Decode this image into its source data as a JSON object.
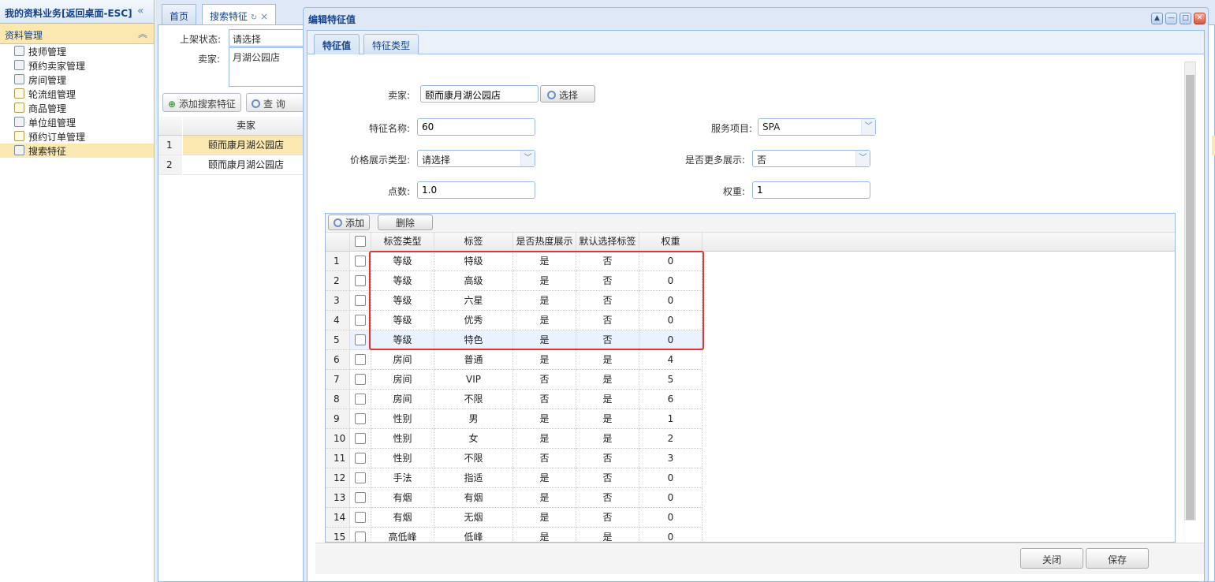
{
  "sidebar": {
    "title": "我的资料业务[返回桌面-ESC]",
    "section": "资料管理",
    "items": [
      {
        "label": "技师管理",
        "icon": "user-icon"
      },
      {
        "label": "预约卖家管理",
        "icon": "user-icon"
      },
      {
        "label": "房间管理",
        "icon": "user-icon"
      },
      {
        "label": "轮流组管理",
        "icon": "doc-icon"
      },
      {
        "label": "商品管理",
        "icon": "doc-icon"
      },
      {
        "label": "单位组管理",
        "icon": "user-icon"
      },
      {
        "label": "预约订单管理",
        "icon": "doc-icon"
      },
      {
        "label": "搜索特征",
        "icon": "user-icon",
        "active": true
      }
    ]
  },
  "tabs": [
    {
      "label": "首页"
    },
    {
      "label": "搜索特征 ",
      "refresh": "↻",
      "close": "×"
    }
  ],
  "background": {
    "status_label": "上架状态:",
    "status_value": "请选择",
    "seller_label": "卖家:",
    "seller_value": "月湖公园店",
    "add_button": "添加搜索特征",
    "query_button": "查 询",
    "column_seller": "卖家",
    "rows": [
      {
        "num": "1",
        "seller": "颐而康月湖公园店"
      },
      {
        "num": "2",
        "seller": "颐而康月湖公园店"
      }
    ]
  },
  "dialog": {
    "title": "编辑特征值",
    "tabs": [
      "特征值",
      "特征类型"
    ],
    "form": {
      "seller_label": "卖家:",
      "seller_value": "颐而康月湖公园店",
      "select_button": "选择",
      "name_label": "特征名称:",
      "name_value": "60",
      "service_label": "服务项目:",
      "service_value": "SPA",
      "price_type_label": "价格展示类型:",
      "price_type_value": "请选择",
      "more_label": "是否更多展示:",
      "more_value": "否",
      "points_label": "点数:",
      "points_value": "1.0",
      "weight_label": "权重:",
      "weight_value": "1"
    },
    "grid": {
      "add_button": "添加",
      "delete_button": "删除",
      "columns": [
        "标签类型",
        "标签",
        "是否热度展示",
        "默认选择标签",
        "权重"
      ],
      "rows": [
        {
          "num": "1",
          "type": "等级",
          "tag": "特级",
          "hot": "是",
          "default": "否",
          "weight": "0"
        },
        {
          "num": "2",
          "type": "等级",
          "tag": "高级",
          "hot": "是",
          "default": "否",
          "weight": "0"
        },
        {
          "num": "3",
          "type": "等级",
          "tag": "六星",
          "hot": "是",
          "default": "否",
          "weight": "0"
        },
        {
          "num": "4",
          "type": "等级",
          "tag": "优秀",
          "hot": "是",
          "default": "否",
          "weight": "0"
        },
        {
          "num": "5",
          "type": "等级",
          "tag": "特色",
          "hot": "是",
          "default": "否",
          "weight": "0"
        },
        {
          "num": "6",
          "type": "房间",
          "tag": "普通",
          "hot": "是",
          "default": "是",
          "weight": "4"
        },
        {
          "num": "7",
          "type": "房间",
          "tag": "VIP",
          "hot": "否",
          "default": "是",
          "weight": "5"
        },
        {
          "num": "8",
          "type": "房间",
          "tag": "不限",
          "hot": "否",
          "default": "是",
          "weight": "6"
        },
        {
          "num": "9",
          "type": "性别",
          "tag": "男",
          "hot": "是",
          "default": "是",
          "weight": "1"
        },
        {
          "num": "10",
          "type": "性别",
          "tag": "女",
          "hot": "是",
          "default": "是",
          "weight": "2"
        },
        {
          "num": "11",
          "type": "性别",
          "tag": "不限",
          "hot": "否",
          "default": "否",
          "weight": "3"
        },
        {
          "num": "12",
          "type": "手法",
          "tag": "指适",
          "hot": "是",
          "default": "否",
          "weight": "0"
        },
        {
          "num": "13",
          "type": "有烟",
          "tag": "有烟",
          "hot": "是",
          "default": "否",
          "weight": "0"
        },
        {
          "num": "14",
          "type": "有烟",
          "tag": "无烟",
          "hot": "是",
          "default": "否",
          "weight": "0"
        },
        {
          "num": "15",
          "type": "高低峰",
          "tag": "低峰",
          "hot": "是",
          "default": "是",
          "weight": "0"
        }
      ]
    },
    "close_button": "关闭",
    "save_button": "保存"
  },
  "colors": {
    "accent": "#15428b",
    "border": "#99bbe8",
    "highlight": "#e53232",
    "active_row": "#fbe8b0"
  }
}
